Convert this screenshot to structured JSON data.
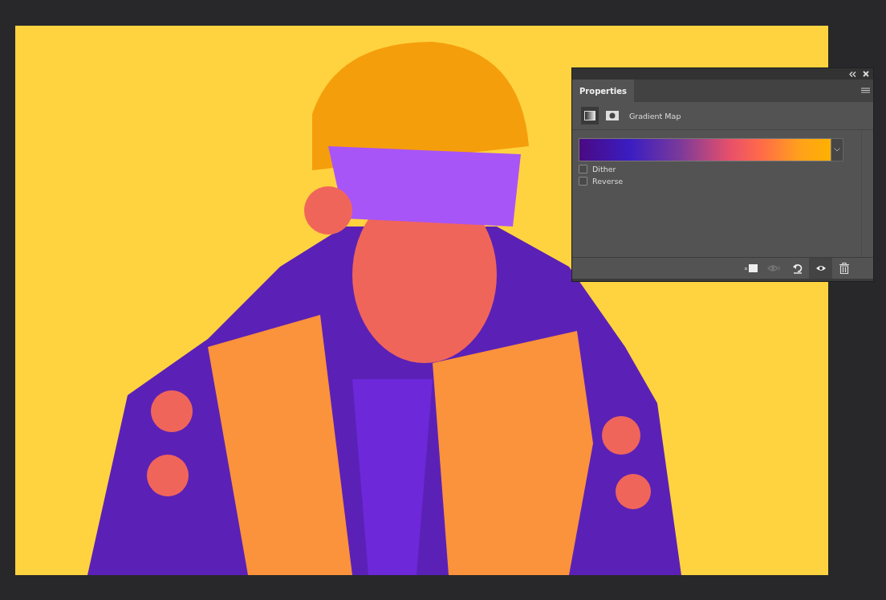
{
  "properties_panel": {
    "tab": {
      "label": "Properties",
      "selected": true
    },
    "adjustment": {
      "title": "Gradient Map"
    },
    "options": [
      {
        "label": "Dither",
        "checked": false
      },
      {
        "label": "Reverse",
        "checked": false
      }
    ]
  }
}
